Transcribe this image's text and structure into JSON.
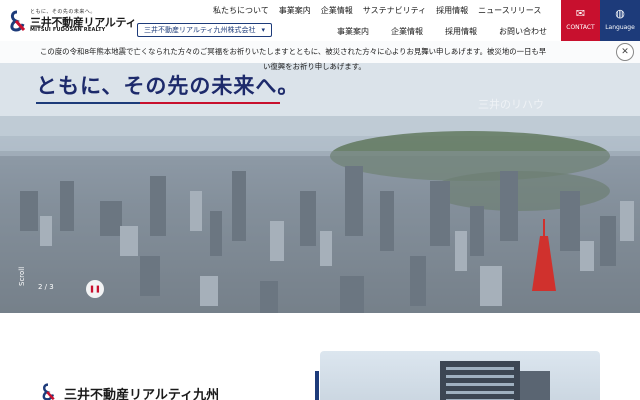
{
  "brand": {
    "tagline": "ともに、その先の未来へ。",
    "name": "三井不動産リアルティ",
    "name_en": "MITSUI FUDOSAN REALTY"
  },
  "top_nav": [
    "私たちについて",
    "事業案内",
    "企業情報",
    "サステナビリティ",
    "採用情報",
    "ニュースリリース"
  ],
  "company_selector": {
    "label": "三井不動産リアルティ九州株式会社"
  },
  "sub_nav": [
    "事業案内",
    "企業情報",
    "採用情報",
    "お問い合わせ"
  ],
  "contact": {
    "label": "CONTACT",
    "icon": "mail-icon"
  },
  "language": {
    "label": "Language",
    "icon": "globe-icon"
  },
  "notice": {
    "line1": "この度の令和8年熊本地震で亡くなられた方々のご冥福をお祈りいたしますとともに、被災された方々に心よりお見舞い申しあげます。被災地の一日も早",
    "line2": "い復興をお祈り申しあげます。"
  },
  "hero": {
    "title": "ともに、その先の未来へ。",
    "scroll_label": "Scroll",
    "slide_indicator": "2 / 3",
    "ghost_caption": "三井のリハウ"
  },
  "bottom": {
    "company_name": "三井不動産リアルティ九州"
  },
  "colors": {
    "brand_red": "#c8102e",
    "brand_navy": "#1d3b7a"
  }
}
